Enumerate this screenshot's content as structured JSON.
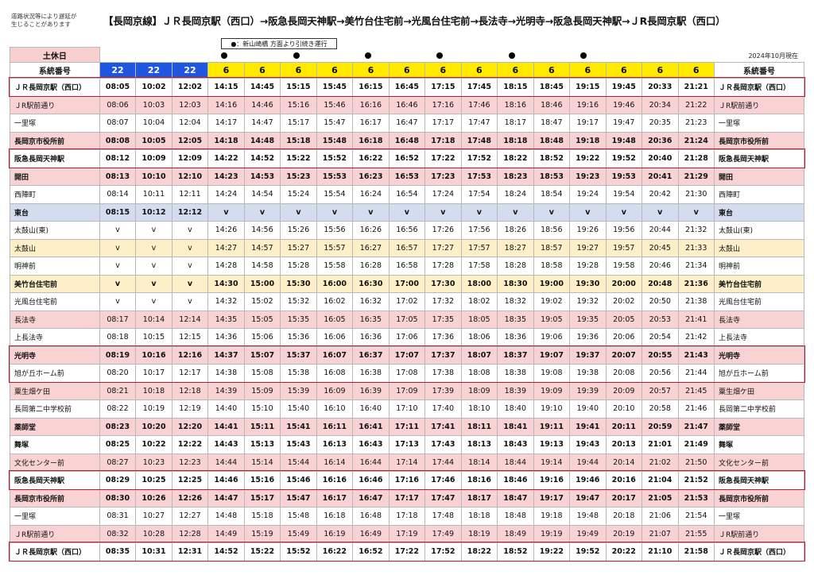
{
  "notice": "道路状況等により遅延が\n生じることがあります",
  "title": "【長岡京線】ＪＲ長岡京駅（西口）→阪急長岡天神駅→美竹台住宅前→光風台住宅前→長法寺→光明寺→阪急長岡天神駅→ＪR長岡京駅（西口）",
  "via_note": "●：新山崎橋 方面より引続き運行",
  "as_of": "2024年10月現在",
  "day_label": "土休日",
  "route_label": "系統番号",
  "routes": [
    "22",
    "22",
    "22",
    "6",
    "6",
    "6",
    "6",
    "6",
    "6",
    "6",
    "6",
    "6",
    "6",
    "6",
    "6",
    "6",
    "6"
  ],
  "dot_columns": [
    3,
    5,
    7,
    9,
    11,
    13
  ],
  "stops": [
    {
      "name": "ＪＲ長岡京駅（西口）",
      "style": "white",
      "bold": true,
      "times": [
        "08:05",
        "10:02",
        "12:02",
        "14:15",
        "14:45",
        "15:15",
        "15:45",
        "16:15",
        "16:45",
        "17:15",
        "17:45",
        "18:15",
        "18:45",
        "19:15",
        "19:45",
        "20:33",
        "21:21"
      ]
    },
    {
      "name": "ＪR駅前通り",
      "style": "pink",
      "bold": false,
      "times": [
        "08:06",
        "10:03",
        "12:03",
        "14:16",
        "14:46",
        "15:16",
        "15:46",
        "16:16",
        "16:46",
        "17:16",
        "17:46",
        "18:16",
        "18:46",
        "19:16",
        "19:46",
        "20:34",
        "21:22"
      ]
    },
    {
      "name": "一里塚",
      "style": "white",
      "bold": false,
      "times": [
        "08:07",
        "10:04",
        "12:04",
        "14:17",
        "14:47",
        "15:17",
        "15:47",
        "16:17",
        "16:47",
        "17:17",
        "17:47",
        "18:17",
        "18:47",
        "19:17",
        "19:47",
        "20:35",
        "21:23"
      ]
    },
    {
      "name": "長岡京市役所前",
      "style": "pink",
      "bold": true,
      "times": [
        "08:08",
        "10:05",
        "12:05",
        "14:18",
        "14:48",
        "15:18",
        "15:48",
        "16:18",
        "16:48",
        "17:18",
        "17:48",
        "18:18",
        "18:48",
        "19:18",
        "19:48",
        "20:36",
        "21:24"
      ]
    },
    {
      "name": "阪急長岡天神駅",
      "style": "white",
      "bold": true,
      "times": [
        "08:12",
        "10:09",
        "12:09",
        "14:22",
        "14:52",
        "15:22",
        "15:52",
        "16:22",
        "16:52",
        "17:22",
        "17:52",
        "18:22",
        "18:52",
        "19:22",
        "19:52",
        "20:40",
        "21:28"
      ]
    },
    {
      "name": "開田",
      "style": "pink",
      "bold": true,
      "times": [
        "08:13",
        "10:10",
        "12:10",
        "14:23",
        "14:53",
        "15:23",
        "15:53",
        "16:23",
        "16:53",
        "17:23",
        "17:53",
        "18:23",
        "18:53",
        "19:23",
        "19:53",
        "20:41",
        "21:29"
      ]
    },
    {
      "name": "西陣町",
      "style": "white",
      "bold": false,
      "times": [
        "08:14",
        "10:11",
        "12:11",
        "14:24",
        "14:54",
        "15:24",
        "15:54",
        "16:24",
        "16:54",
        "17:24",
        "17:54",
        "18:24",
        "18:54",
        "19:24",
        "19:54",
        "20:42",
        "21:30"
      ]
    },
    {
      "name": "東台",
      "style": "blue",
      "bold": true,
      "times": [
        "08:15",
        "10:12",
        "12:12",
        "v",
        "v",
        "v",
        "v",
        "v",
        "v",
        "v",
        "v",
        "v",
        "v",
        "v",
        "v",
        "v",
        "v"
      ]
    },
    {
      "name": "太鼓山(東)",
      "style": "white",
      "bold": false,
      "times": [
        "v",
        "v",
        "v",
        "14:26",
        "14:56",
        "15:26",
        "15:56",
        "16:26",
        "16:56",
        "17:26",
        "17:56",
        "18:26",
        "18:56",
        "19:26",
        "19:56",
        "20:44",
        "21:32"
      ]
    },
    {
      "name": "太鼓山",
      "style": "yellow",
      "bold": false,
      "times": [
        "v",
        "v",
        "v",
        "14:27",
        "14:57",
        "15:27",
        "15:57",
        "16:27",
        "16:57",
        "17:27",
        "17:57",
        "18:27",
        "18:57",
        "19:27",
        "19:57",
        "20:45",
        "21:33"
      ]
    },
    {
      "name": "明神前",
      "style": "white",
      "bold": false,
      "times": [
        "v",
        "v",
        "v",
        "14:28",
        "14:58",
        "15:28",
        "15:58",
        "16:28",
        "16:58",
        "17:28",
        "17:58",
        "18:28",
        "18:58",
        "19:28",
        "19:58",
        "20:46",
        "21:34"
      ]
    },
    {
      "name": "美竹台住宅前",
      "style": "yellow",
      "bold": true,
      "times": [
        "v",
        "v",
        "v",
        "14:30",
        "15:00",
        "15:30",
        "16:00",
        "16:30",
        "17:00",
        "17:30",
        "18:00",
        "18:30",
        "19:00",
        "19:30",
        "20:00",
        "20:48",
        "21:36"
      ]
    },
    {
      "name": "光風台住宅前",
      "style": "white",
      "bold": false,
      "times": [
        "v",
        "v",
        "v",
        "14:32",
        "15:02",
        "15:32",
        "16:02",
        "16:32",
        "17:02",
        "17:32",
        "18:02",
        "18:32",
        "19:02",
        "19:32",
        "20:02",
        "20:50",
        "21:38"
      ]
    },
    {
      "name": "長法寺",
      "style": "pink",
      "bold": false,
      "times": [
        "08:17",
        "10:14",
        "12:14",
        "14:35",
        "15:05",
        "15:35",
        "16:05",
        "16:35",
        "17:05",
        "17:35",
        "18:05",
        "18:35",
        "19:05",
        "19:35",
        "20:05",
        "20:53",
        "21:41"
      ]
    },
    {
      "name": "上長法寺",
      "style": "white",
      "bold": false,
      "times": [
        "08:18",
        "10:15",
        "12:15",
        "14:36",
        "15:06",
        "15:36",
        "16:06",
        "16:36",
        "17:06",
        "17:36",
        "18:06",
        "18:36",
        "19:06",
        "19:36",
        "20:06",
        "20:54",
        "21:42"
      ]
    },
    {
      "name": "光明寺",
      "style": "pink",
      "bold": true,
      "times": [
        "08:19",
        "10:16",
        "12:16",
        "14:37",
        "15:07",
        "15:37",
        "16:07",
        "16:37",
        "17:07",
        "17:37",
        "18:07",
        "18:37",
        "19:07",
        "19:37",
        "20:07",
        "20:55",
        "21:43"
      ]
    },
    {
      "name": "旭が丘ホーム前",
      "style": "white",
      "bold": false,
      "times": [
        "08:20",
        "10:17",
        "12:17",
        "14:38",
        "15:08",
        "15:38",
        "16:08",
        "16:38",
        "17:08",
        "17:38",
        "18:08",
        "18:38",
        "19:08",
        "19:38",
        "20:08",
        "20:56",
        "21:44"
      ]
    },
    {
      "name": "粟生畑ケ田",
      "style": "pink",
      "bold": false,
      "times": [
        "08:21",
        "10:18",
        "12:18",
        "14:39",
        "15:09",
        "15:39",
        "16:09",
        "16:39",
        "17:09",
        "17:39",
        "18:09",
        "18:39",
        "19:09",
        "19:39",
        "20:09",
        "20:57",
        "21:45"
      ]
    },
    {
      "name": "長岡第二中学校前",
      "style": "white",
      "bold": false,
      "times": [
        "08:22",
        "10:19",
        "12:19",
        "14:40",
        "15:10",
        "15:40",
        "16:10",
        "16:40",
        "17:10",
        "17:40",
        "18:10",
        "18:40",
        "19:10",
        "19:40",
        "20:10",
        "20:58",
        "21:46"
      ]
    },
    {
      "name": "薬師堂",
      "style": "pink",
      "bold": true,
      "times": [
        "08:23",
        "10:20",
        "12:20",
        "14:41",
        "15:11",
        "15:41",
        "16:11",
        "16:41",
        "17:11",
        "17:41",
        "18:11",
        "18:41",
        "19:11",
        "19:41",
        "20:11",
        "20:59",
        "21:47"
      ]
    },
    {
      "name": "舞塚",
      "style": "white",
      "bold": true,
      "times": [
        "08:25",
        "10:22",
        "12:22",
        "14:43",
        "15:13",
        "15:43",
        "16:13",
        "16:43",
        "17:13",
        "17:43",
        "18:13",
        "18:43",
        "19:13",
        "19:43",
        "20:13",
        "21:01",
        "21:49"
      ]
    },
    {
      "name": "文化センター前",
      "style": "pink",
      "bold": false,
      "times": [
        "08:27",
        "10:23",
        "12:23",
        "14:44",
        "15:14",
        "15:44",
        "16:14",
        "16:44",
        "17:14",
        "17:44",
        "18:14",
        "18:44",
        "19:14",
        "19:44",
        "20:14",
        "21:02",
        "21:50"
      ]
    },
    {
      "name": "阪急長岡天神駅",
      "style": "white",
      "bold": true,
      "times": [
        "08:29",
        "10:25",
        "12:25",
        "14:46",
        "15:16",
        "15:46",
        "16:16",
        "16:46",
        "17:16",
        "17:46",
        "18:16",
        "18:46",
        "19:16",
        "19:46",
        "20:16",
        "21:04",
        "21:52"
      ]
    },
    {
      "name": "長岡京市役所前",
      "style": "pink",
      "bold": true,
      "times": [
        "08:30",
        "10:26",
        "12:26",
        "14:47",
        "15:17",
        "15:47",
        "16:17",
        "16:47",
        "17:17",
        "17:47",
        "18:17",
        "18:47",
        "19:17",
        "19:47",
        "20:17",
        "21:05",
        "21:53"
      ]
    },
    {
      "name": "一里塚",
      "style": "white",
      "bold": false,
      "times": [
        "08:31",
        "10:27",
        "12:27",
        "14:48",
        "15:18",
        "15:48",
        "16:18",
        "16:48",
        "17:18",
        "17:48",
        "18:18",
        "18:48",
        "19:18",
        "19:48",
        "20:18",
        "21:06",
        "21:54"
      ]
    },
    {
      "name": "ＪR駅前通り",
      "style": "pink",
      "bold": false,
      "times": [
        "08:32",
        "10:28",
        "12:28",
        "14:49",
        "15:19",
        "15:49",
        "16:19",
        "16:49",
        "17:19",
        "17:49",
        "18:19",
        "18:49",
        "19:19",
        "19:49",
        "20:19",
        "21:07",
        "21:55"
      ]
    },
    {
      "name": "ＪＲ長岡京駅（西口）",
      "style": "white",
      "bold": true,
      "times": [
        "08:35",
        "10:31",
        "12:31",
        "14:52",
        "15:22",
        "15:52",
        "16:22",
        "16:52",
        "17:22",
        "17:52",
        "18:22",
        "18:52",
        "19:22",
        "19:52",
        "20:22",
        "21:10",
        "21:58"
      ]
    }
  ],
  "highlights": [
    [
      0,
      0
    ],
    [
      4,
      4
    ],
    [
      15,
      16
    ],
    [
      22,
      22
    ],
    [
      26,
      26
    ]
  ]
}
